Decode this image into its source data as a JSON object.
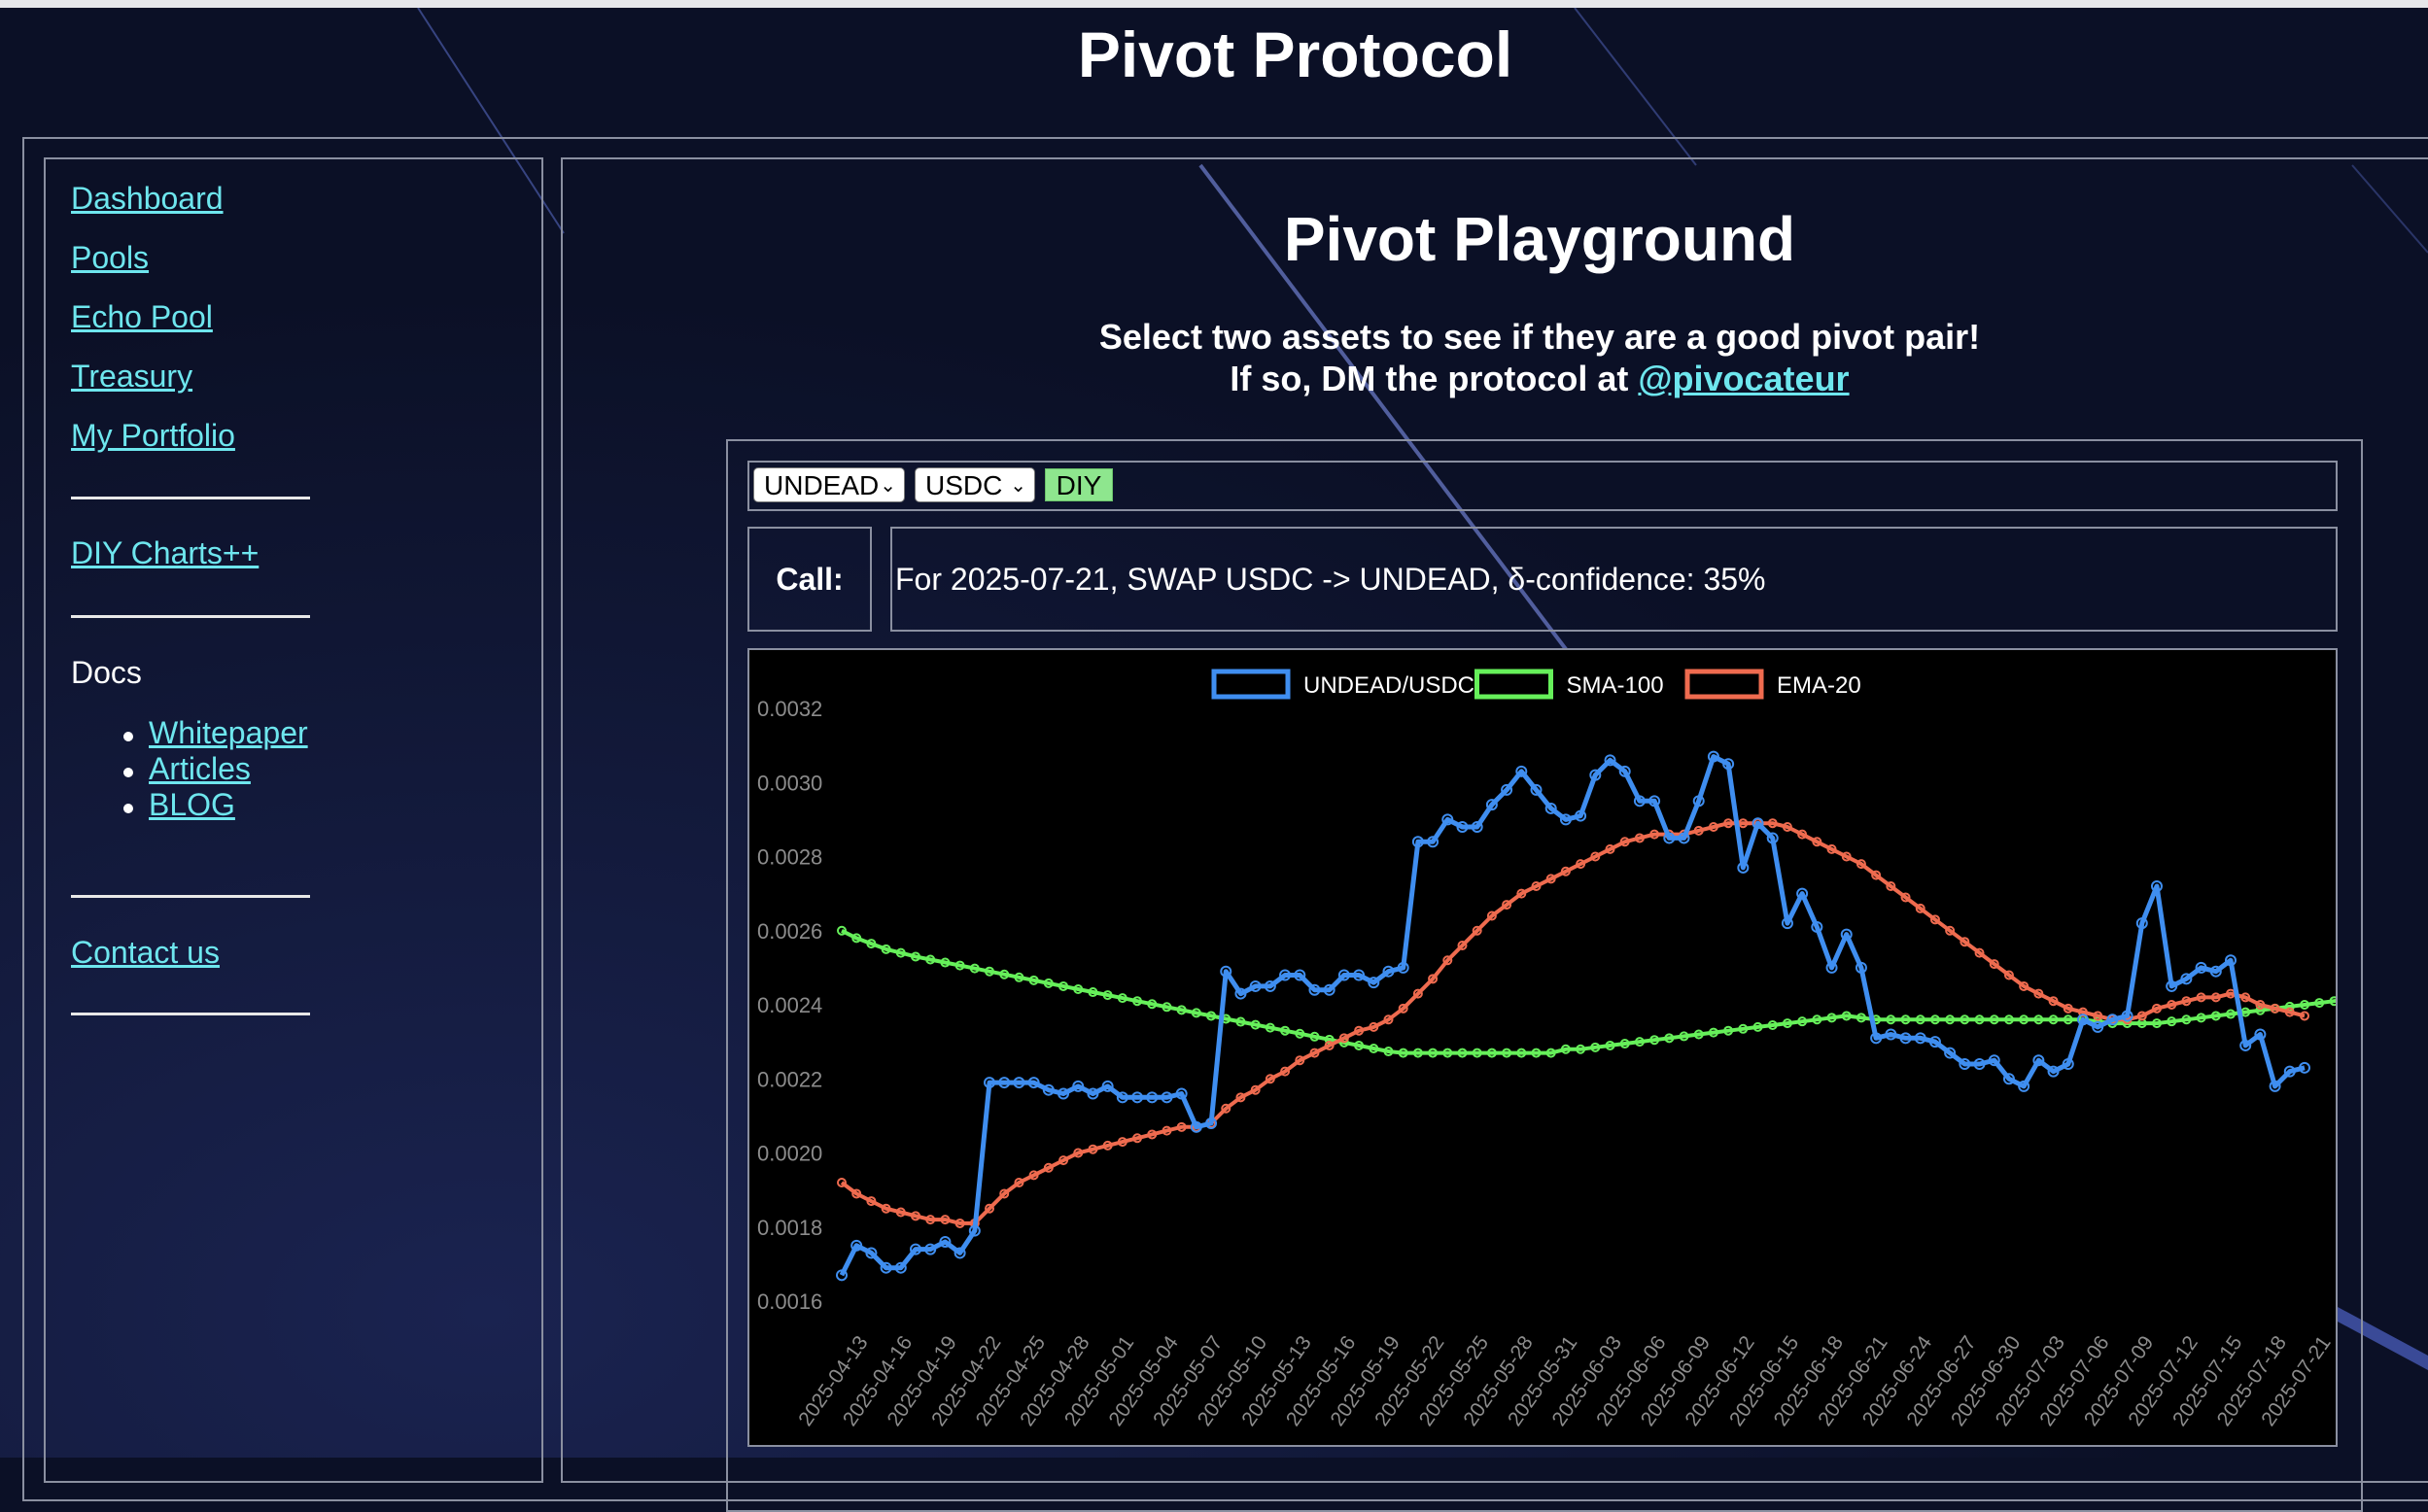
{
  "site": {
    "title": "Pivot Protocol"
  },
  "sidebar": {
    "links": [
      "Dashboard",
      "Pools",
      "Echo Pool",
      "Treasury",
      "My Portfolio"
    ],
    "diy_link": "DIY Charts++",
    "docs_label": "Docs",
    "docs_links": [
      "Whitepaper",
      "Articles",
      "BLOG"
    ],
    "contact_link": "Contact us"
  },
  "main": {
    "title": "Pivot Playground",
    "subtitle_line1": "Select two assets to see if they are a good pivot pair!",
    "subtitle_line2_prefix": "If so, DM the protocol at ",
    "subtitle_handle": "@pivocateur"
  },
  "controls": {
    "asset1": "UNDEAD",
    "asset2": "USDC",
    "button_label": "DIY"
  },
  "call": {
    "label": "Call:",
    "text": "For 2025-07-21, SWAP USDC -> UNDEAD, δ-confidence: 35%"
  },
  "colors": {
    "link": "#6ee6ee",
    "series_price": "#3f8ef0",
    "series_sma": "#66f05a",
    "series_ema": "#ef6b4f",
    "diy_button": "#8ee68e"
  },
  "chart_data": {
    "type": "line",
    "ylim": [
      0.0016,
      0.0032
    ],
    "yticks": [
      "0.0032",
      "0.0030",
      "0.0028",
      "0.0026",
      "0.0024",
      "0.0022",
      "0.0020",
      "0.0018",
      "0.0016"
    ],
    "x_start": "2025-04-13",
    "x_end": "2025-07-22",
    "x_tick_labels": [
      "2025-04-13",
      "2025-04-16",
      "2025-04-19",
      "2025-04-22",
      "2025-04-25",
      "2025-04-28",
      "2025-05-01",
      "2025-05-04",
      "2025-05-07",
      "2025-05-10",
      "2025-05-13",
      "2025-05-16",
      "2025-05-19",
      "2025-05-22",
      "2025-05-25",
      "2025-05-28",
      "2025-05-31",
      "2025-06-03",
      "2025-06-06",
      "2025-06-09",
      "2025-06-12",
      "2025-06-15",
      "2025-06-18",
      "2025-06-21",
      "2025-06-24",
      "2025-06-27",
      "2025-06-30",
      "2025-07-03",
      "2025-07-06",
      "2025-07-09",
      "2025-07-12",
      "2025-07-15",
      "2025-07-18",
      "2025-07-21"
    ],
    "series": [
      {
        "name": "UNDEAD/USDC",
        "color": "#3f8ef0",
        "values": [
          0.00167,
          0.00175,
          0.00173,
          0.00169,
          0.00169,
          0.00174,
          0.00174,
          0.00176,
          0.00173,
          0.00179,
          0.00219,
          0.00219,
          0.00219,
          0.00219,
          0.00217,
          0.00216,
          0.00218,
          0.00216,
          0.00218,
          0.00215,
          0.00215,
          0.00215,
          0.00215,
          0.00216,
          0.00207,
          0.00208,
          0.00249,
          0.00243,
          0.00245,
          0.00245,
          0.00248,
          0.00248,
          0.00244,
          0.00244,
          0.00248,
          0.00248,
          0.00246,
          0.00249,
          0.0025,
          0.00284,
          0.00284,
          0.0029,
          0.00288,
          0.00288,
          0.00294,
          0.00298,
          0.00303,
          0.00298,
          0.00293,
          0.0029,
          0.00291,
          0.00302,
          0.00306,
          0.00303,
          0.00295,
          0.00295,
          0.00285,
          0.00285,
          0.00295,
          0.00307,
          0.00305,
          0.00277,
          0.00289,
          0.00285,
          0.00262,
          0.0027,
          0.00261,
          0.0025,
          0.00259,
          0.0025,
          0.00231,
          0.00232,
          0.00231,
          0.00231,
          0.0023,
          0.00227,
          0.00224,
          0.00224,
          0.00225,
          0.0022,
          0.00218,
          0.00225,
          0.00222,
          0.00224,
          0.00236,
          0.00234,
          0.00236,
          0.00237,
          0.00262,
          0.00272,
          0.00245,
          0.00247,
          0.0025,
          0.00249,
          0.00252,
          0.00229,
          0.00232,
          0.00218,
          0.00222,
          0.00223
        ]
      },
      {
        "name": "SMA-100",
        "color": "#66f05a",
        "values": [
          0.0026,
          0.00258,
          0.002565,
          0.00255,
          0.00254,
          0.00253,
          0.002522,
          0.002514,
          0.002506,
          0.002498,
          0.00249,
          0.002482,
          0.002474,
          0.002466,
          0.002458,
          0.00245,
          0.002442,
          0.002434,
          0.002426,
          0.002418,
          0.00241,
          0.002402,
          0.002394,
          0.002386,
          0.002378,
          0.00237,
          0.002362,
          0.002354,
          0.002346,
          0.002338,
          0.00233,
          0.002322,
          0.002314,
          0.002306,
          0.002298,
          0.00229,
          0.002282,
          0.002274,
          0.00227,
          0.00227,
          0.00227,
          0.00227,
          0.00227,
          0.00227,
          0.00227,
          0.00227,
          0.00227,
          0.00227,
          0.00227,
          0.00228,
          0.00228,
          0.002285,
          0.00229,
          0.002295,
          0.0023,
          0.002305,
          0.00231,
          0.002315,
          0.00232,
          0.002325,
          0.00233,
          0.002335,
          0.00234,
          0.002345,
          0.00235,
          0.002355,
          0.00236,
          0.002365,
          0.00237,
          0.002365,
          0.00236,
          0.00236,
          0.00236,
          0.00236,
          0.00236,
          0.00236,
          0.00236,
          0.00236,
          0.00236,
          0.00236,
          0.00236,
          0.00236,
          0.00236,
          0.00236,
          0.00236,
          0.002355,
          0.00235,
          0.00235,
          0.00235,
          0.00235,
          0.002355,
          0.00236,
          0.002365,
          0.00237,
          0.002375,
          0.00238,
          0.002385,
          0.00239,
          0.002395,
          0.0024,
          0.002405,
          0.00241,
          0.002415
        ]
      },
      {
        "name": "EMA-20",
        "color": "#ef6b4f",
        "values": [
          0.00192,
          0.00189,
          0.00187,
          0.00185,
          0.00184,
          0.00183,
          0.00182,
          0.00182,
          0.00181,
          0.00181,
          0.00185,
          0.00189,
          0.00192,
          0.00194,
          0.00196,
          0.00198,
          0.002,
          0.00201,
          0.00202,
          0.00203,
          0.00204,
          0.00205,
          0.00206,
          0.00207,
          0.00207,
          0.00208,
          0.00212,
          0.00215,
          0.00217,
          0.0022,
          0.00222,
          0.00225,
          0.00227,
          0.00229,
          0.00231,
          0.00233,
          0.00234,
          0.00236,
          0.00239,
          0.00243,
          0.00247,
          0.00252,
          0.00256,
          0.0026,
          0.00264,
          0.00267,
          0.0027,
          0.00272,
          0.00274,
          0.00276,
          0.00278,
          0.0028,
          0.00282,
          0.00284,
          0.00285,
          0.00286,
          0.00286,
          0.00286,
          0.00287,
          0.00288,
          0.00289,
          0.00289,
          0.00289,
          0.00289,
          0.00288,
          0.00286,
          0.00284,
          0.00282,
          0.0028,
          0.00278,
          0.00275,
          0.00272,
          0.00269,
          0.00266,
          0.00263,
          0.0026,
          0.00257,
          0.00254,
          0.00251,
          0.00248,
          0.00245,
          0.00243,
          0.00241,
          0.00239,
          0.00238,
          0.00237,
          0.00236,
          0.00236,
          0.00237,
          0.00239,
          0.0024,
          0.00241,
          0.00242,
          0.00242,
          0.00243,
          0.00242,
          0.0024,
          0.00239,
          0.00238,
          0.00237
        ]
      }
    ]
  }
}
